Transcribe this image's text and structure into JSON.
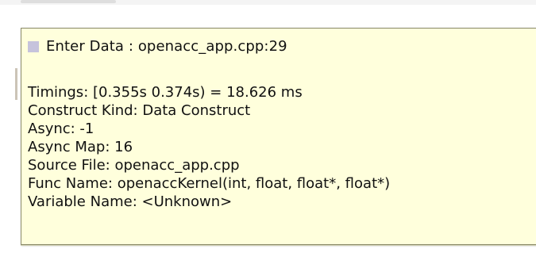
{
  "tooltip": {
    "swatch_color": "#c6c3dc",
    "header": "Enter Data : openacc_app.cpp:29",
    "lines": [
      "Timings: [0.355s 0.374s) = 18.626 ms",
      "Construct Kind: Data Construct",
      "Async: -1",
      "Async Map: 16",
      "Source File: openacc_app.cpp",
      "Func Name: openaccKernel(int, float, float*, float*)",
      "Variable Name: <Unknown>"
    ]
  }
}
